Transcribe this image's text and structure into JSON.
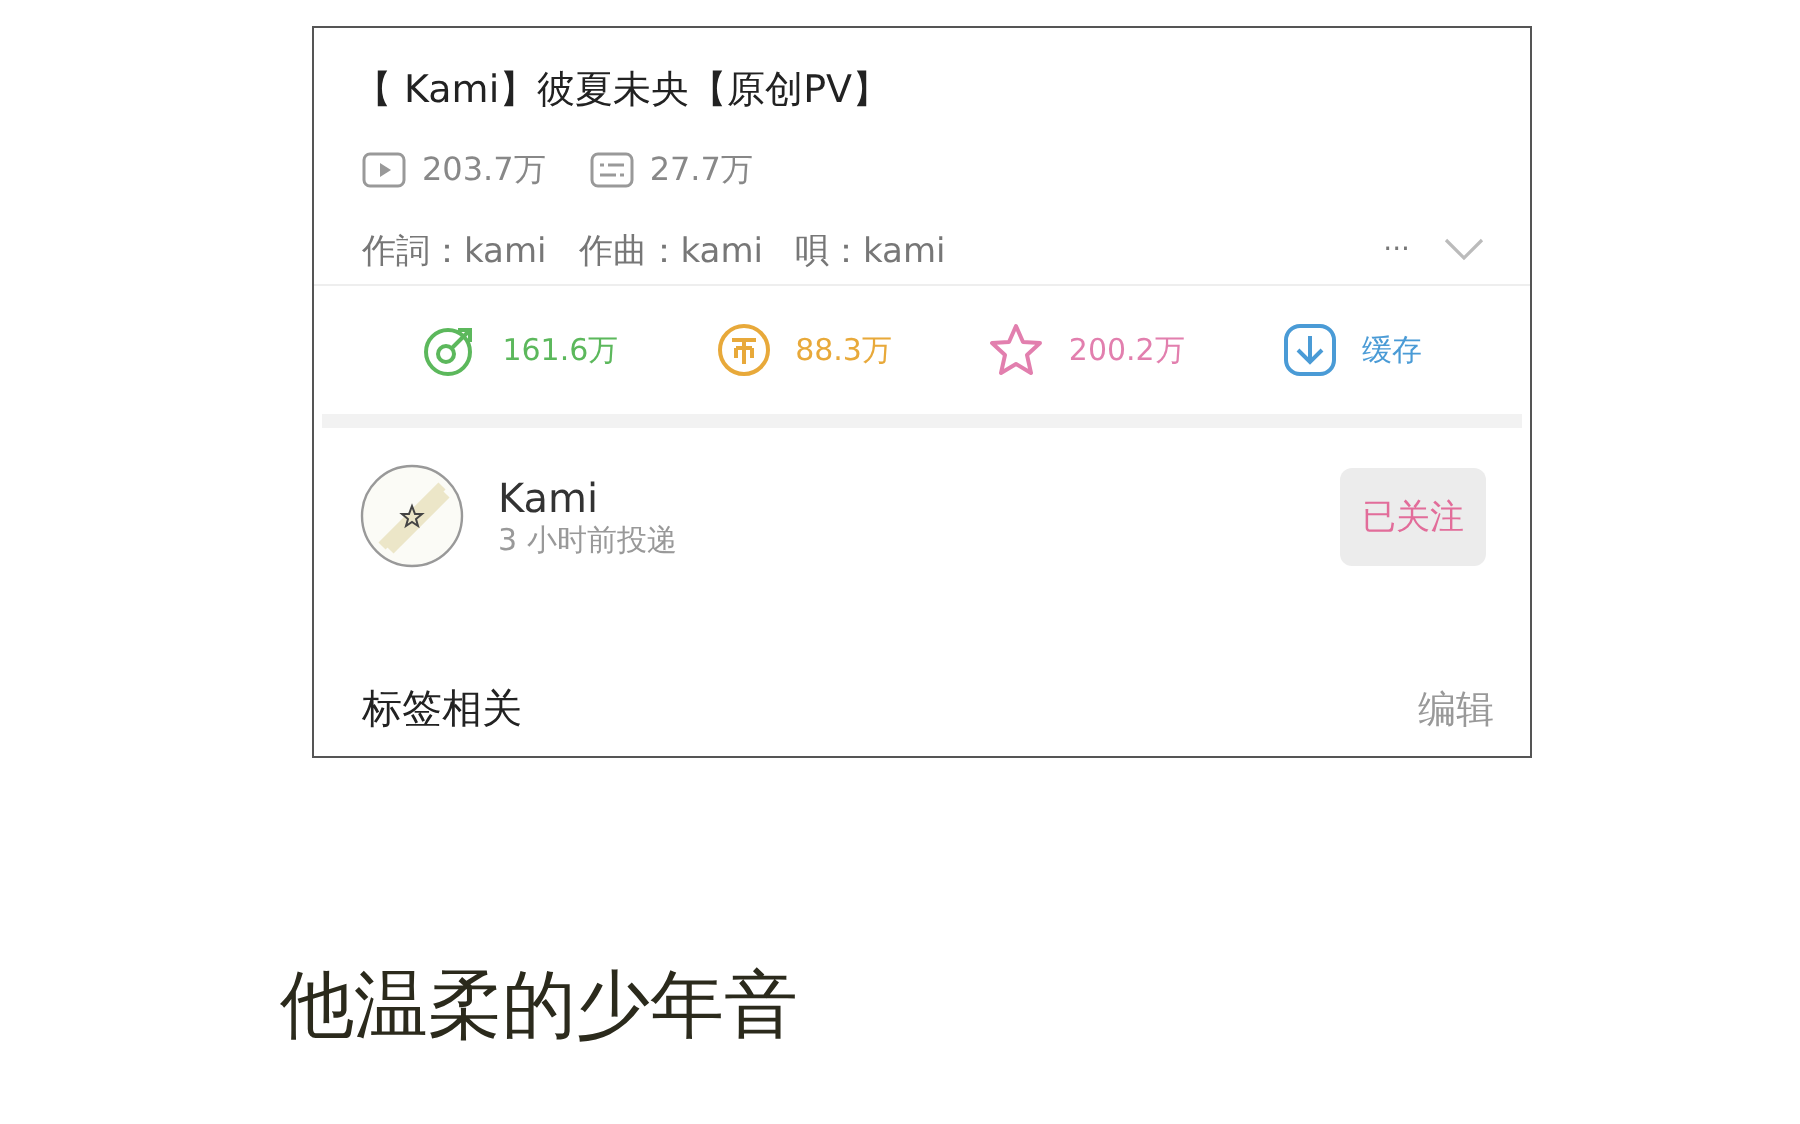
{
  "video": {
    "title": "【 Kami】彼夏未央【原创PV】",
    "stats": [
      {
        "kind": "play",
        "text": "203.7万"
      },
      {
        "kind": "danmaku",
        "text": "27.7万"
      }
    ],
    "credits": [
      "作詞：kami",
      "作曲：kami",
      "唄：kami"
    ],
    "more": "···"
  },
  "actions": [
    {
      "kind": "like",
      "text": "161.6万",
      "color": "#5cb85c"
    },
    {
      "kind": "coin",
      "text": "88.3万",
      "color": "#e8a93a"
    },
    {
      "kind": "star",
      "text": "200.2万",
      "color": "#e27fae"
    },
    {
      "kind": "download",
      "text": "缓存",
      "color": "#4a9bd6"
    }
  ],
  "uploader": {
    "name": "Kami",
    "time": "3 小时前投递",
    "follow": "已关注",
    "followed": true
  },
  "tags": {
    "title": "标签相关",
    "edit": "编辑"
  },
  "caption": "他温柔的少年音"
}
